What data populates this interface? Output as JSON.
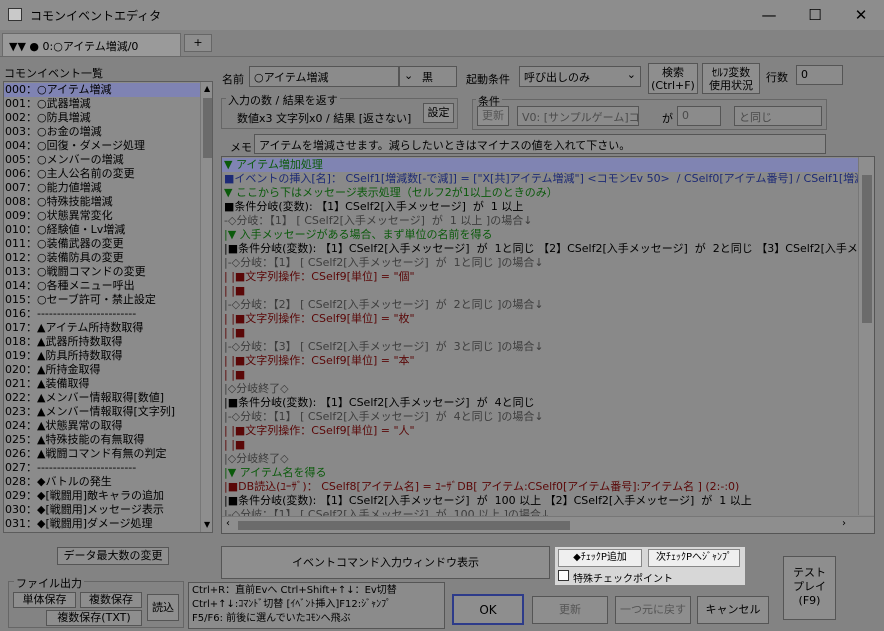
{
  "window": {
    "title": "コモンイベントエディタ",
    "min": "—",
    "max": "☐",
    "close": "✕"
  },
  "tab": {
    "label": "▼▼ ● 0:○アイテム増減/0",
    "add": "+"
  },
  "sidebar": {
    "title": "コモンイベント一覧",
    "items": [
      "000：○アイテム増減",
      "001：○武器増減",
      "002：○防具増減",
      "003：○お金の増減",
      "004：○回復・ダメージ処理",
      "005：○メンバーの増減",
      "006：○主人公名前の変更",
      "007：○能力値増減",
      "008：○特殊技能増減",
      "009：○状態異常変化",
      "010：○経験値・Lv増減",
      "011：○装備武器の変更",
      "012：○装備防具の変更",
      "013：○戦闘コマンドの変更",
      "014：○各種メニュー呼出",
      "015：○セーブ許可・禁止設定",
      "016：-------------------------",
      "017：▲アイテム所持数取得",
      "018：▲武器所持数取得",
      "019：▲防具所持数取得",
      "020：▲所持金取得",
      "021：▲装備取得",
      "022：▲メンバー情報取得[数値]",
      "023：▲メンバー情報取得[文字列]",
      "024：▲状態異常の取得",
      "025：▲特殊技能の有無取得",
      "026：▲戦闘コマンド有無の判定",
      "027：-------------------------",
      "028：◆バトルの発生",
      "029：◆[戦闘用]敵キャラの追加",
      "030：◆[戦闘用]メッセージ表示",
      "031：◆[戦闘用]ダメージ処理"
    ]
  },
  "header": {
    "name_label": "名前",
    "name_value": "○アイテム増減",
    "color_value": "黒",
    "trigger_label": "起動条件",
    "trigger_value": "呼び出しのみ",
    "search_btn": "検索\n(Ctrl+F)",
    "selfvar_btn": "ｾﾙﾌ変数\n使用状況",
    "rows_label": "行数",
    "rows_value": "0",
    "io_label": "入力の数 / 結果を返す",
    "io_value": "数値x3 文字列x0 / 結果 [返さない]",
    "setting_btn": "設定",
    "cond_label": "条件",
    "cond_update": "更新",
    "cond_var": "V0: [サンプルゲーム]コッ",
    "cond_ga": "が",
    "cond_num": "0",
    "cond_op": "と同じ",
    "memo_label": "メモ",
    "memo_value": "アイテムを増減させます。減らしたいときはマイナスの値を入れて下さい。"
  },
  "code_lines": [
    {
      "t": "▼ アイテム増加処理",
      "c": "green",
      "hl": true
    },
    {
      "t": "■イベントの挿入[名]： CSelf1[増減数[-で減]] = [\"X[共]アイテム増減\"] <コモンEv 50>  / CSelf0[アイテム番号] / CSelf1[増減数[-",
      "c": "blue"
    },
    {
      "t": "▼ ここから下はメッセージ表示処理（セルフ2が1以上のときのみ）",
      "c": "green"
    },
    {
      "t": "■条件分岐(変数): 【1】CSelf2[入手メッセージ]  が  1 以上",
      "c": "black"
    },
    {
      "t": "-◇分岐：【1】 [ CSelf2[入手メッセージ]  が  1 以上 ]の場合↓",
      "c": "gray"
    },
    {
      "t": "|▼ 入手メッセージがある場合、まず単位の名前を得る",
      "c": "green"
    },
    {
      "t": "|■条件分岐(変数): 【1】CSelf2[入手メッセージ]  が  1と同じ 【2】CSelf2[入手メッセージ]  が  2と同じ 【3】CSelf2[入手メッセー",
      "c": "black"
    },
    {
      "t": "|-◇分岐：【1】 [ CSelf2[入手メッセージ]  が  1と同じ ]の場合↓",
      "c": "gray"
    },
    {
      "t": "| |■文字列操作：CSelf9[単位] = \"個\"",
      "c": "red"
    },
    {
      "t": "| |■",
      "c": "red"
    },
    {
      "t": "|-◇分岐：【2】 [ CSelf2[入手メッセージ]  が  2と同じ ]の場合↓",
      "c": "gray"
    },
    {
      "t": "| |■文字列操作：CSelf9[単位] = \"枚\"",
      "c": "red"
    },
    {
      "t": "| |■",
      "c": "red"
    },
    {
      "t": "|-◇分岐：【3】 [ CSelf2[入手メッセージ]  が  3と同じ ]の場合↓",
      "c": "gray"
    },
    {
      "t": "| |■文字列操作：CSelf9[単位] = \"本\"",
      "c": "red"
    },
    {
      "t": "| |■",
      "c": "red"
    },
    {
      "t": "|◇分岐終了◇",
      "c": "gray"
    },
    {
      "t": "|■条件分岐(変数): 【1】CSelf2[入手メッセージ]  が  4と同じ",
      "c": "black"
    },
    {
      "t": "|-◇分岐：【1】 [ CSelf2[入手メッセージ]  が  4と同じ ]の場合↓",
      "c": "gray"
    },
    {
      "t": "| |■文字列操作：CSelf9[単位] = \"人\"",
      "c": "red"
    },
    {
      "t": "| |■",
      "c": "red"
    },
    {
      "t": "|◇分岐終了◇",
      "c": "gray"
    },
    {
      "t": "|▼ アイテム名を得る",
      "c": "green"
    },
    {
      "t": "|■DB読込(ﾕｰｻﾞ)： CSelf8[アイテム名] = ﾕｰｻﾞDB[ アイテム:CSelf0[アイテム番号]:アイテム名 ] (2:-:0)",
      "c": "red"
    },
    {
      "t": "|■条件分岐(変数): 【1】CSelf2[入手メッセージ]  が  100 以上 【2】CSelf2[入手メッセージ]  が  1 以上",
      "c": "black"
    },
    {
      "t": "|-◇分岐：【1】 [ CSelf2[入手メッセージ]  が  100 以上 ]の場合↓",
      "c": "gray"
    }
  ],
  "bottom": {
    "datamax_btn": "データ最大数の変更",
    "cmdwin_btn": "イベントコマンド入力ウィンドウ表示",
    "chkadd_btn": "◆ﾁｪｯｸP追加",
    "chkjump_btn": "次ﾁｪｯｸPへｼﾞｬﾝﾌﾟ",
    "special_chk": "特殊チェックポイント",
    "fileout_label": "ファイル出力",
    "single_save": "単体保存",
    "multi_save": "複数保存",
    "load_btn": "読込",
    "multi_save_txt": "複数保存(TXT)",
    "help_lines": [
      "Ctrl+R：直前Evへ  Ctrl+Shift+↑↓：Ev切替",
      "Ctrl+↑↓:ｺﾏﾝﾄﾞ切替 [ｲﾍﾞﾝﾄ挿入]F12:ｼﾞｬﾝﾌﾟ",
      "F5/F6: 前後に選んでいたｺﾓﾝへ飛ぶ"
    ],
    "ok_btn": "OK",
    "update_btn": "更新",
    "undo_btn": "一つ元に戻す",
    "cancel_btn": "キャンセル",
    "test_btn": "テスト\nプレイ\n(F9)"
  }
}
